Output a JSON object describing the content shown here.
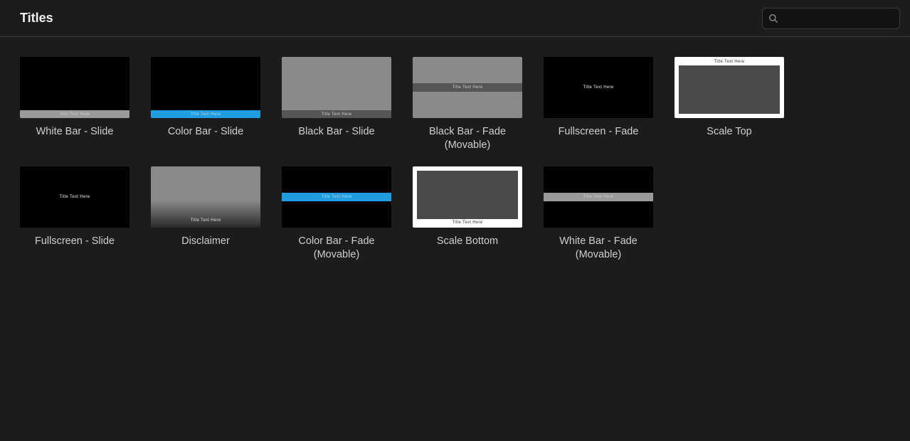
{
  "header": {
    "title": "Titles"
  },
  "search": {
    "placeholder": ""
  },
  "thumb_text": "Title Text Here",
  "titles": [
    {
      "id": "white-bar-slide",
      "label": "White Bar - Slide"
    },
    {
      "id": "color-bar-slide",
      "label": "Color Bar - Slide"
    },
    {
      "id": "black-bar-slide",
      "label": "Black Bar - Slide"
    },
    {
      "id": "black-bar-fade",
      "label": "Black Bar - Fade (Movable)"
    },
    {
      "id": "fullscreen-fade",
      "label": "Fullscreen - Fade"
    },
    {
      "id": "scale-top",
      "label": "Scale Top"
    },
    {
      "id": "fullscreen-slide",
      "label": "Fullscreen - Slide"
    },
    {
      "id": "disclaimer",
      "label": "Disclaimer"
    },
    {
      "id": "color-bar-fade",
      "label": "Color Bar - Fade (Movable)"
    },
    {
      "id": "scale-bottom",
      "label": "Scale Bottom"
    },
    {
      "id": "white-bar-fade",
      "label": "White Bar - Fade (Movable)"
    }
  ],
  "colors": {
    "accent_blue": "#1f9de0",
    "gray_bar": "#9a9a9a",
    "dark_bar": "#555555"
  }
}
